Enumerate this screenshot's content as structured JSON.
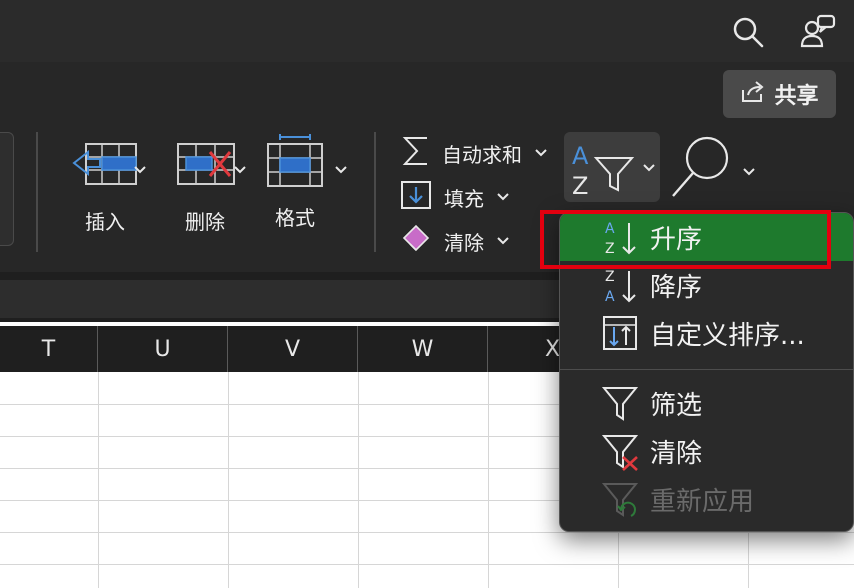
{
  "titlebar": {
    "search_icon": "search-icon",
    "account_icon": "people-chat-icon"
  },
  "toolbar": {
    "share_label": "共享"
  },
  "cells_group": {
    "insert_label": "插入",
    "delete_label": "删除",
    "format_label": "格式"
  },
  "editing_group": {
    "autosum_label": "自动求和",
    "fill_label": "填充",
    "clear_label": "清除"
  },
  "columns": [
    "T",
    "U",
    "V",
    "W",
    "X"
  ],
  "sort_menu": {
    "items": [
      {
        "label": "升序",
        "icon": "sort-ascending-icon",
        "selected": true
      },
      {
        "label": "降序",
        "icon": "sort-descending-icon"
      },
      {
        "label": "自定义排序...",
        "icon": "custom-sort-icon"
      },
      {
        "label": "筛选",
        "icon": "filter-icon"
      },
      {
        "label": "清除",
        "icon": "clear-filter-icon"
      },
      {
        "label": "重新应用",
        "icon": "reapply-filter-icon",
        "disabled": true
      }
    ]
  },
  "colors": {
    "accent_blue": "#4a90d9",
    "selected_green": "#1e7a2d",
    "highlight_red": "#e3000f",
    "delete_red": "#e0393e"
  }
}
